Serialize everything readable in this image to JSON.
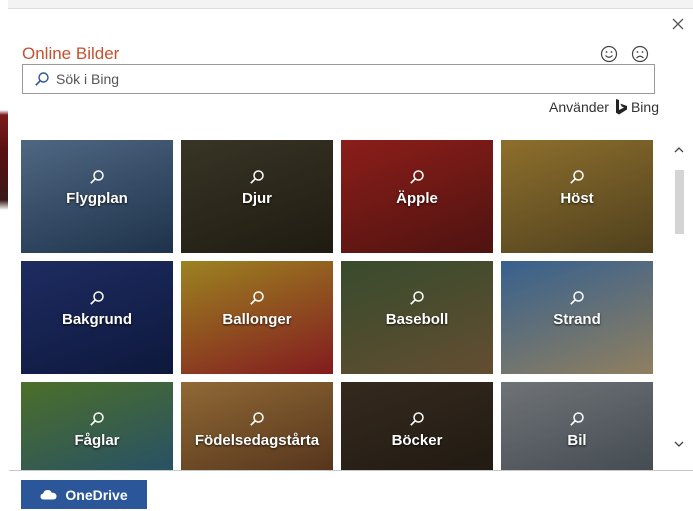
{
  "dialog": {
    "title": "Online Bilder",
    "accent_color": "#c4512f",
    "close_icon": "close-icon",
    "smile_icon": "smiley-happy-icon",
    "frown_icon": "smiley-sad-icon"
  },
  "search": {
    "placeholder": "Sök i Bing",
    "value": ""
  },
  "powered_by": {
    "label": "Använder",
    "brand": "Bing"
  },
  "tiles": [
    {
      "label": "Flygplan",
      "colors": [
        "#6f8fb5",
        "#2a4668"
      ]
    },
    {
      "label": "Djur",
      "colors": [
        "#4e4a35",
        "#2c2618"
      ]
    },
    {
      "label": "Äpple",
      "colors": [
        "#c22a24",
        "#6d1b17"
      ]
    },
    {
      "label": "Höst",
      "colors": [
        "#c59a3e",
        "#6e5a2a"
      ]
    },
    {
      "label": "Bakgrund",
      "colors": [
        "#2a3d86",
        "#142255"
      ]
    },
    {
      "label": "Ballonger",
      "colors": [
        "#d8b62e",
        "#b6262c"
      ]
    },
    {
      "label": "Baseboll",
      "colors": [
        "#4e6a3e",
        "#8a6b45"
      ]
    },
    {
      "label": "Strand",
      "colors": [
        "#4c86c6",
        "#c7b185"
      ]
    },
    {
      "label": "Fåglar",
      "colors": [
        "#6a9a3a",
        "#2f6a9a"
      ]
    },
    {
      "label": "Födelsedagstårta",
      "colors": [
        "#c8924a",
        "#6a3e22"
      ]
    },
    {
      "label": "Böcker",
      "colors": [
        "#4a3a2a",
        "#2a2218"
      ]
    },
    {
      "label": "Bil",
      "colors": [
        "#9aa0a6",
        "#56606a"
      ]
    }
  ],
  "footer": {
    "onedrive_label": "OneDrive",
    "onedrive_color": "#2b579a"
  }
}
